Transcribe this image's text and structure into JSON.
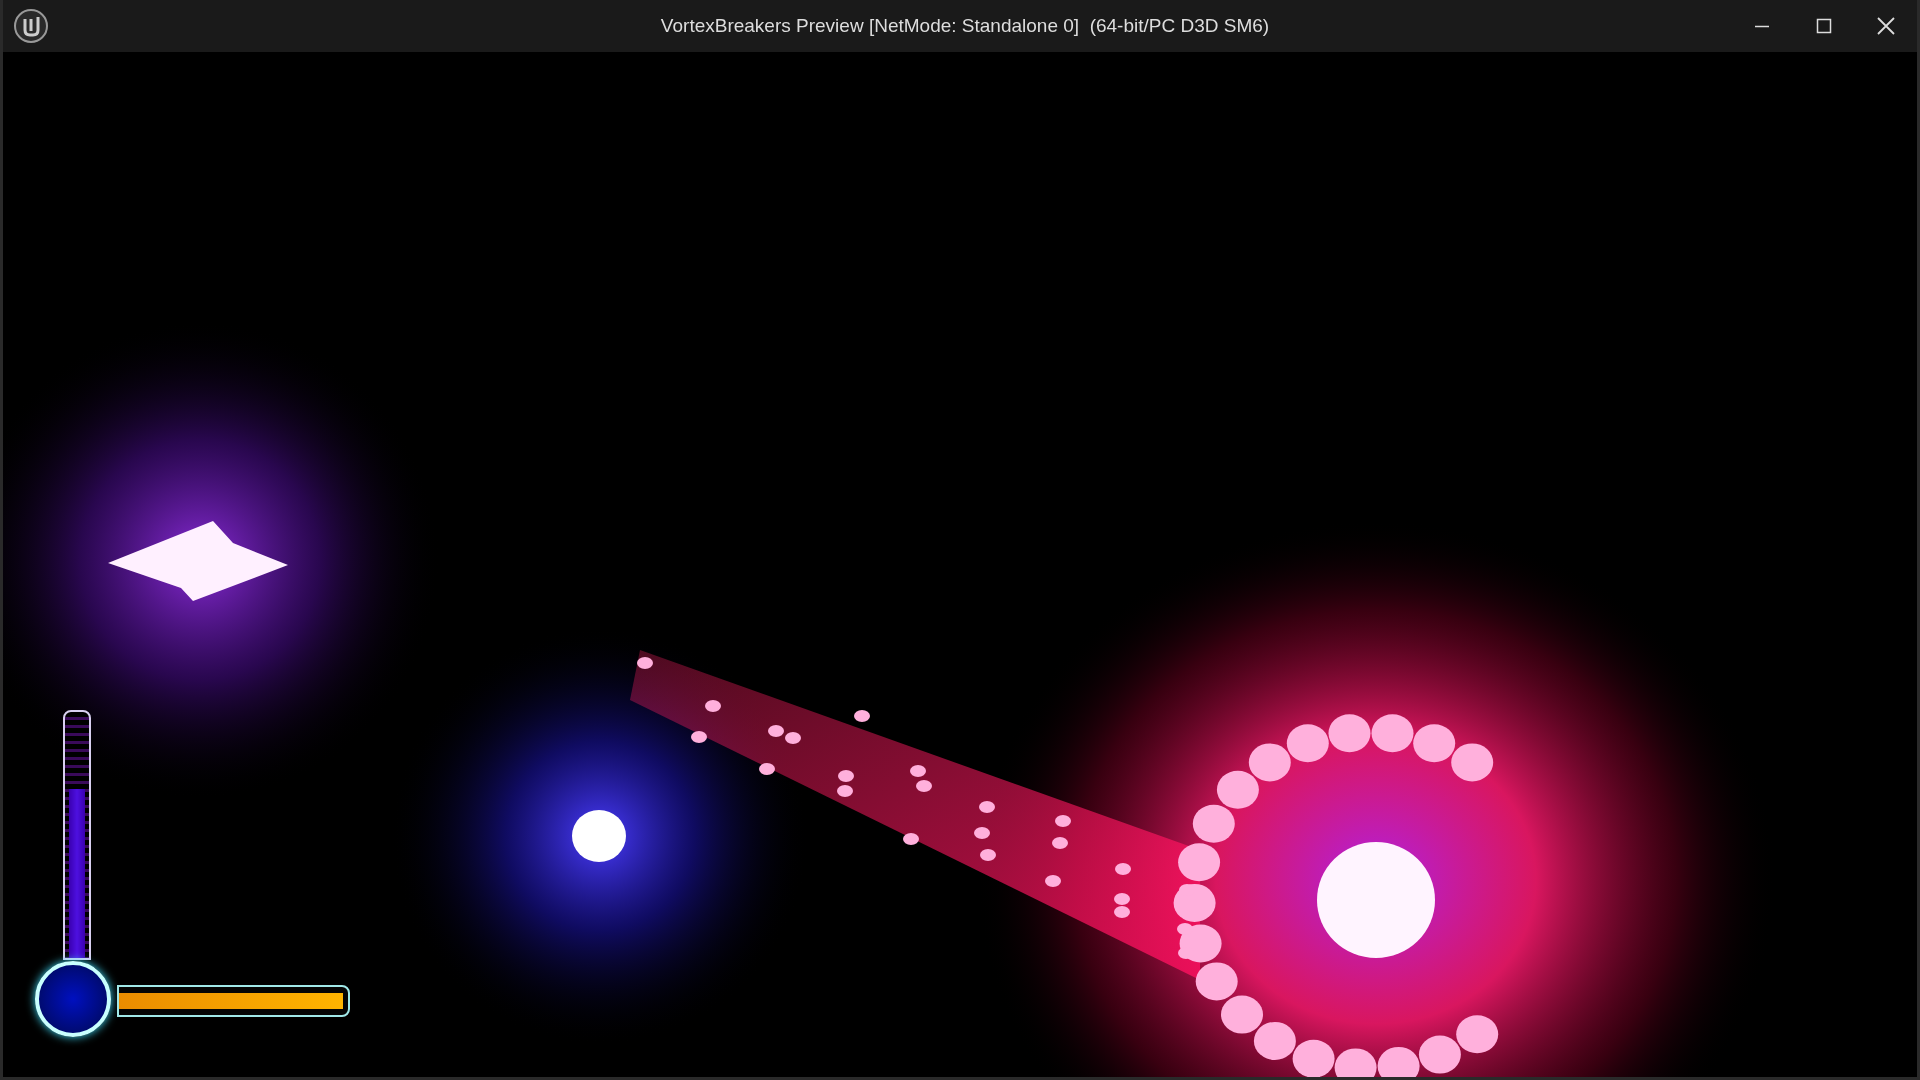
{
  "window": {
    "title": "VortexBreakers Preview [NetMode: Standalone 0]  (64-bit/PC D3D SM6)"
  },
  "hud": {
    "vertical_meter": {
      "level": 0.7
    },
    "horizontal_bar": {
      "level": 0.98
    }
  }
}
